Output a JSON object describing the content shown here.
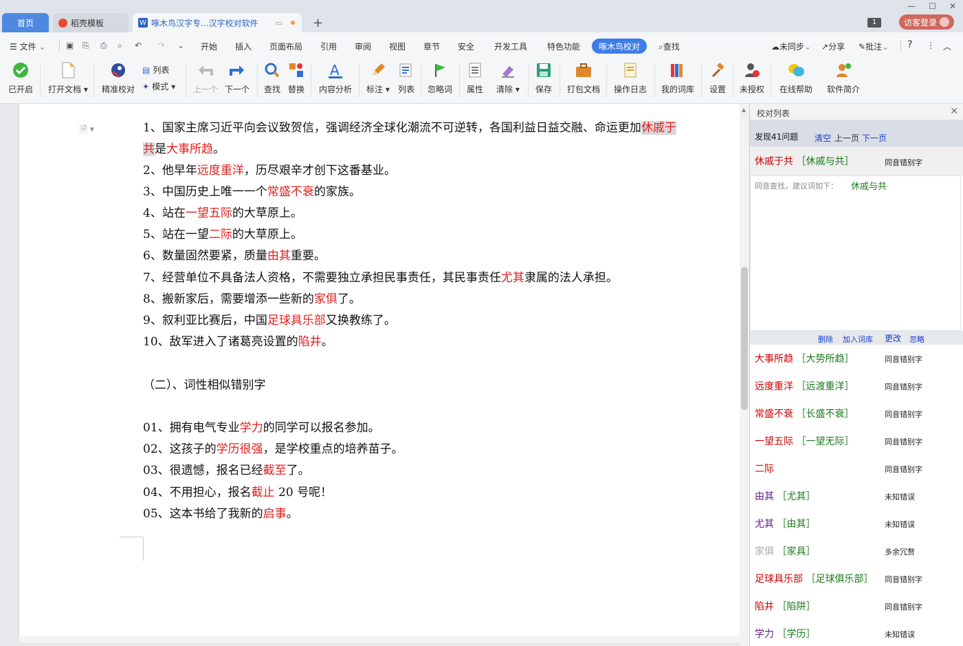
{
  "titlebar": {
    "tab_home": "首页",
    "tab_template": "稻壳模板",
    "tab_doc": "啄木鸟汉字专...汉字校对软件",
    "add_tab": "+",
    "badge": "1",
    "login": "访客登录"
  },
  "menubar": {
    "file": "文件",
    "items": [
      "开始",
      "插入",
      "页面布局",
      "引用",
      "审阅",
      "视图",
      "章节",
      "安全",
      "开发工具",
      "特色功能"
    ],
    "active": "啄木鸟校对",
    "search": "查找",
    "sync": "未同步",
    "share": "分享",
    "comment": "批注"
  },
  "toolbar": {
    "opened": "已开启",
    "open_doc": "打开文档",
    "precise": "精准校对",
    "list": "列表",
    "mode": "模式",
    "prev": "上一个",
    "next": "下一个",
    "find": "查找",
    "replace": "替换",
    "content": "内容分析",
    "mark": "标注",
    "list2": "列表",
    "ignore_words": "忽略词",
    "attr": "属性",
    "clear": "清除",
    "save": "保存",
    "pack": "打包文档",
    "log": "操作日志",
    "lexicon": "我的词库",
    "settings": "设置",
    "unauth": "未授权",
    "help": "在线帮助",
    "intro": "软件简介"
  },
  "document": {
    "lines": [
      {
        "parts": [
          {
            "t": "1、国家主席习近平向会议致贺信，强调经济全球化潮流不可逆转，各国利益日益交融、命运更加"
          },
          {
            "t": "休戚于",
            "e": true,
            "h": true
          }
        ]
      },
      {
        "parts": [
          {
            "t": "共",
            "e": true,
            "h": true
          },
          {
            "t": "是"
          },
          {
            "t": "大事所趋",
            "e": true
          },
          {
            "t": "。"
          }
        ]
      },
      {
        "parts": [
          {
            "t": "2、他早年"
          },
          {
            "t": "远度重洋",
            "e": true
          },
          {
            "t": "，历尽艰辛才创下这番基业。"
          }
        ]
      },
      {
        "parts": [
          {
            "t": "3、中国历史上唯一一个"
          },
          {
            "t": "常盛不衰",
            "e": true
          },
          {
            "t": "的家族。"
          }
        ]
      },
      {
        "parts": [
          {
            "t": "4、站在"
          },
          {
            "t": "一望五际",
            "e": true
          },
          {
            "t": "的大草原上。"
          }
        ]
      },
      {
        "parts": [
          {
            "t": "5、站在一望"
          },
          {
            "t": "二际",
            "e": true
          },
          {
            "t": "的大草原上。"
          }
        ]
      },
      {
        "parts": [
          {
            "t": "6、数量固然要紧，质量"
          },
          {
            "t": "由其",
            "e": true
          },
          {
            "t": "重要。"
          }
        ]
      },
      {
        "parts": [
          {
            "t": "7、经营单位不具备法人资格，不需要独立承担民事责任，其民事责任"
          },
          {
            "t": "尤其",
            "e": true
          },
          {
            "t": "隶属的法人承担。"
          }
        ]
      },
      {
        "parts": [
          {
            "t": "8、搬新家后，需要增添一些新的"
          },
          {
            "t": "家俱",
            "e": true
          },
          {
            "t": "了。"
          }
        ]
      },
      {
        "parts": [
          {
            "t": "9、叙利亚比赛后，中国"
          },
          {
            "t": "足球具乐部",
            "e": true
          },
          {
            "t": "又换教练了。"
          }
        ]
      },
      {
        "parts": [
          {
            "t": "10、敌军进入了诸葛亮设置的"
          },
          {
            "t": "陷井",
            "e": true
          },
          {
            "t": "。"
          }
        ]
      },
      {
        "parts": []
      },
      {
        "parts": [
          {
            "t": "（二）、词性相似错别字"
          }
        ]
      },
      {
        "parts": []
      },
      {
        "parts": [
          {
            "t": "01、拥有电气专业"
          },
          {
            "t": "学力",
            "e": true
          },
          {
            "t": "的同学可以报名参加。"
          }
        ]
      },
      {
        "parts": [
          {
            "t": "02、这孩子的"
          },
          {
            "t": "学历很强",
            "e": true
          },
          {
            "t": "，是学校重点的培养苗子。"
          }
        ]
      },
      {
        "parts": [
          {
            "t": "03、很遗憾，报名已经"
          },
          {
            "t": "截至",
            "e": true
          },
          {
            "t": "了。"
          }
        ]
      },
      {
        "parts": [
          {
            "t": "04、不用担心，报名"
          },
          {
            "t": "截止",
            "e": true
          },
          {
            "t": " 20 号呢！"
          }
        ]
      },
      {
        "parts": [
          {
            "t": "05、这本书给了我新的"
          },
          {
            "t": "启事",
            "e": true
          },
          {
            "t": "。"
          }
        ]
      }
    ]
  },
  "panel": {
    "title": "校对列表",
    "found": "发现41问题",
    "clear": "清空",
    "prev_page": "上一页",
    "next_page": "下一页",
    "selected": {
      "wrong": "休戚于共",
      "right": "［休戚与共］",
      "type": "同音错别字"
    },
    "suggest_label": "同音查找，建议词如下：",
    "suggest_word": "休戚与共",
    "actions": {
      "delete": "删除",
      "add": "加入词库",
      "change": "更改",
      "ignore": "忽略"
    },
    "items": [
      {
        "wrong": "大事所趋",
        "right": "［大势所趋］",
        "type": "同音错别字",
        "color": "red"
      },
      {
        "wrong": "远度重洋",
        "right": "［远渡重洋］",
        "type": "同音错别字",
        "color": "red"
      },
      {
        "wrong": "常盛不衰",
        "right": "［长盛不衰］",
        "type": "同音错别字",
        "color": "red"
      },
      {
        "wrong": "一望五际",
        "right": "［一望无际］",
        "type": "同音错别字",
        "color": "red"
      },
      {
        "wrong": "二际",
        "right": "",
        "type": "同音错别字",
        "color": "red"
      },
      {
        "wrong": "由其",
        "right": "［尤其］",
        "type": "未知错误",
        "color": "purple"
      },
      {
        "wrong": "尤其",
        "right": "［由其］",
        "type": "未知错误",
        "color": "purple"
      },
      {
        "wrong": "家俱",
        "right": "［家具］",
        "type": "多余冗赘",
        "color": "gray"
      },
      {
        "wrong": "足球具乐部",
        "right": "［足球俱乐部］",
        "type": "同音错别字",
        "color": "red"
      },
      {
        "wrong": "陷井",
        "right": "［陷阱］",
        "type": "同音错别字",
        "color": "red"
      },
      {
        "wrong": "学力",
        "right": "［学历］",
        "type": "未知错误",
        "color": "purple"
      }
    ]
  }
}
